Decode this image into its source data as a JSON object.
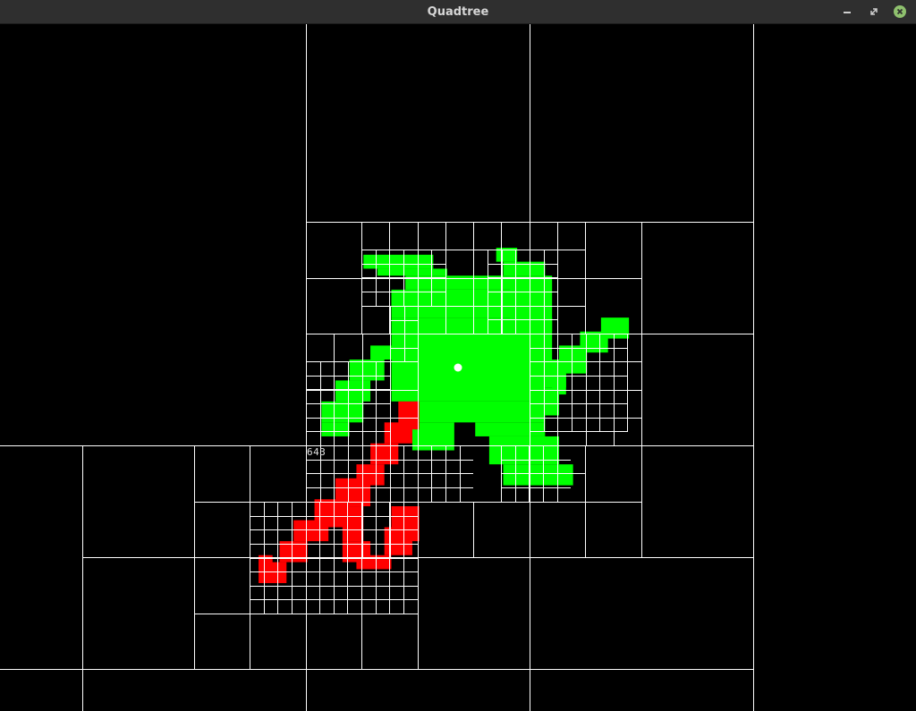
{
  "window": {
    "title": "Quadtree",
    "buttons": [
      "minimize",
      "maximize",
      "close"
    ]
  },
  "overlay": {
    "count": "643"
  },
  "colors": {
    "background": "#000000",
    "grid": "#ffffff",
    "shape_primary": "#00ff00",
    "shape_secondary": "#ff0000",
    "point": "#ffffff",
    "titlebar": "#2f2f2f",
    "close_button": "#8fc16e"
  },
  "icons": {
    "minimize": "minimize-icon",
    "maximize": "maximize-icon",
    "close": "close-icon"
  }
}
